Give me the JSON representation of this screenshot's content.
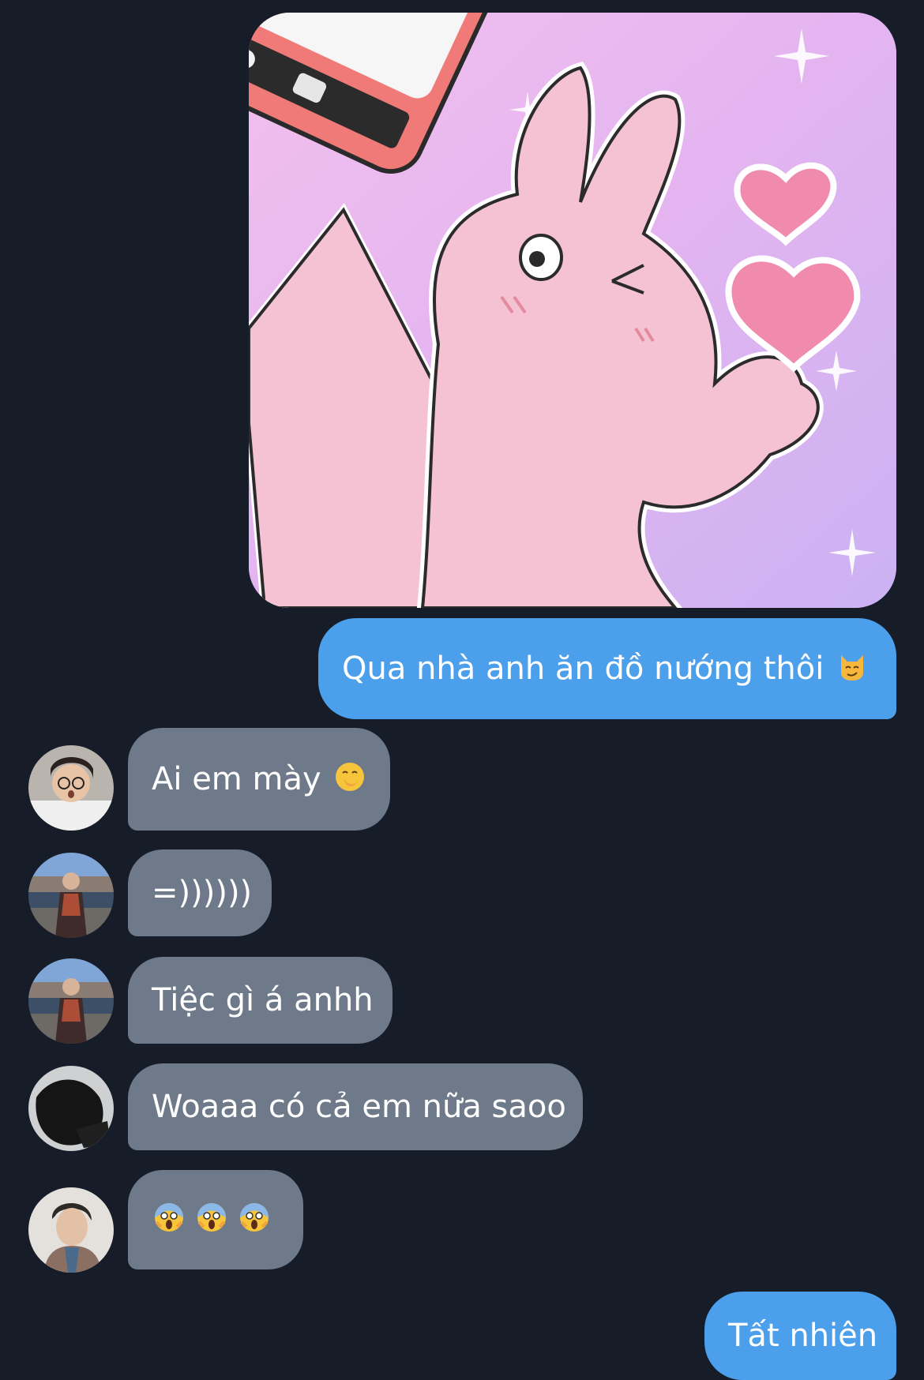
{
  "messages": [
    {
      "id": "m1",
      "direction": "outgoing",
      "type": "sticker",
      "sticker_name": "pink-bunny-selfie-sticker"
    },
    {
      "id": "m2",
      "direction": "outgoing",
      "type": "text",
      "text": "Qua nhà anh ăn đồ nướng thôi",
      "emoji": "smirking-cat-emoji"
    },
    {
      "id": "m3",
      "direction": "incoming",
      "type": "text",
      "text": "Ai em mày",
      "emoji": "face-with-hand-over-mouth-emoji",
      "avatar": "avatar-girl-glasses"
    },
    {
      "id": "m4",
      "direction": "incoming",
      "type": "text",
      "text": "=))))))",
      "avatar": "avatar-man-waterfront"
    },
    {
      "id": "m5",
      "direction": "incoming",
      "type": "text",
      "text": "Tiệc gì á anhh",
      "avatar": "avatar-man-waterfront"
    },
    {
      "id": "m6",
      "direction": "incoming",
      "type": "text",
      "text": "Woaaa có cả em nữa saoo",
      "avatar": "avatar-dark-figure"
    },
    {
      "id": "m7",
      "direction": "incoming",
      "type": "emoji",
      "emojis": [
        "face-screaming-in-fear-emoji",
        "face-screaming-in-fear-emoji",
        "face-screaming-in-fear-emoji"
      ],
      "avatar": "avatar-young-man"
    },
    {
      "id": "m8",
      "direction": "outgoing",
      "type": "text",
      "text": "Tất nhiên"
    }
  ],
  "colors": {
    "background": "#161d29",
    "outgoing_bubble": "#4c9fea",
    "incoming_bubble": "#6e7a89",
    "text": "#ffffff"
  }
}
